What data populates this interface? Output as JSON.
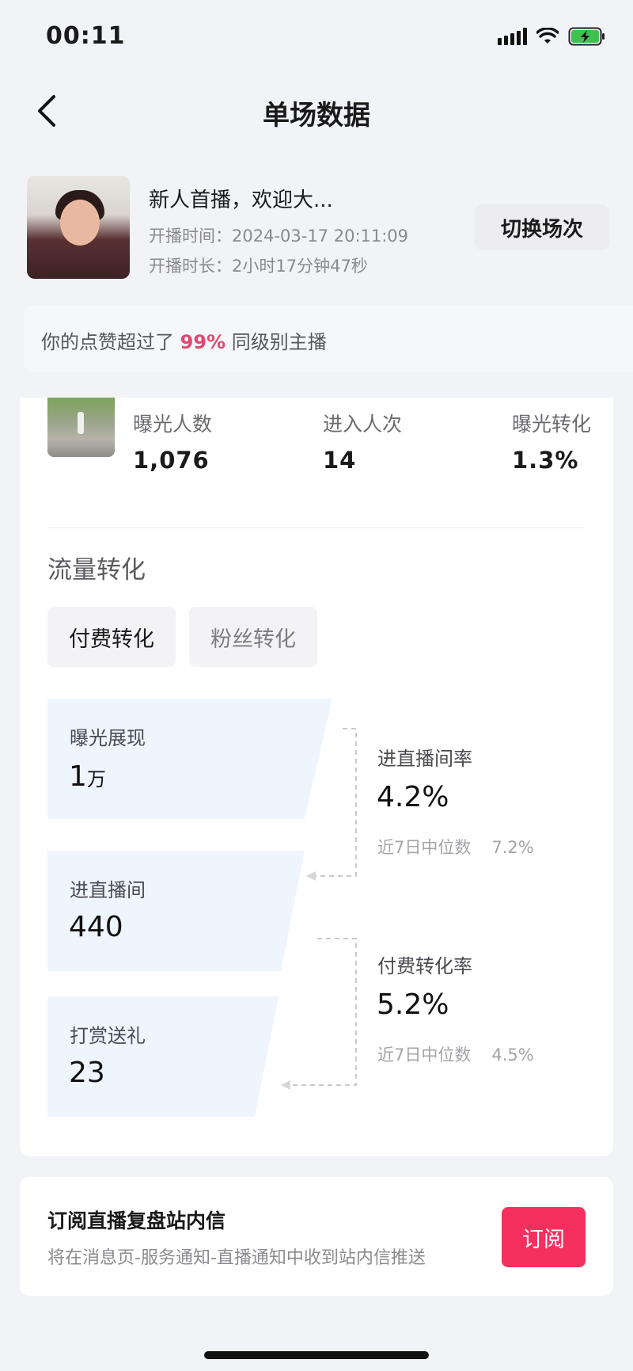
{
  "status_bar": {
    "time": "00:11"
  },
  "header": {
    "title": "单场数据"
  },
  "live": {
    "title": "新人首播，欢迎大...",
    "start_time": "开播时间：2024-03-17 20:11:09",
    "duration": "开播时长：2小时17分钟47秒",
    "switch_label": "切换场次"
  },
  "like_banner": {
    "prefix": "你的点赞超过了",
    "percent": "99%",
    "suffix": "同级别主播"
  },
  "stats": [
    {
      "label": "曝光人数",
      "value": "1,076"
    },
    {
      "label": "进入人次",
      "value": "14"
    },
    {
      "label": "曝光转化",
      "value": "1.3%"
    }
  ],
  "traffic": {
    "title": "流量转化",
    "tabs": [
      {
        "label": "付费转化",
        "active": true
      },
      {
        "label": "粉丝转化",
        "active": false
      }
    ]
  },
  "funnel": {
    "stages": [
      {
        "label": "曝光展现",
        "value": "1",
        "unit": "万"
      },
      {
        "label": "进直播间",
        "value": "440"
      },
      {
        "label": "打赏送礼",
        "value": "23"
      }
    ],
    "rates": [
      {
        "title": "进直播间率",
        "value": "4.2%",
        "median_label": "近7日中位数",
        "median_value": "7.2%"
      },
      {
        "title": "付费转化率",
        "value": "5.2%",
        "median_label": "近7日中位数",
        "median_value": "4.5%"
      }
    ]
  },
  "subscribe": {
    "title": "订阅直播复盘站内信",
    "desc": "将在消息页-服务通知-直播通知中收到站内信推送",
    "button": "订阅"
  },
  "colors": {
    "accent_pink": "#e04a6f",
    "subscribe_button": "#f5305f",
    "funnel_fill": "#eef5fd"
  }
}
